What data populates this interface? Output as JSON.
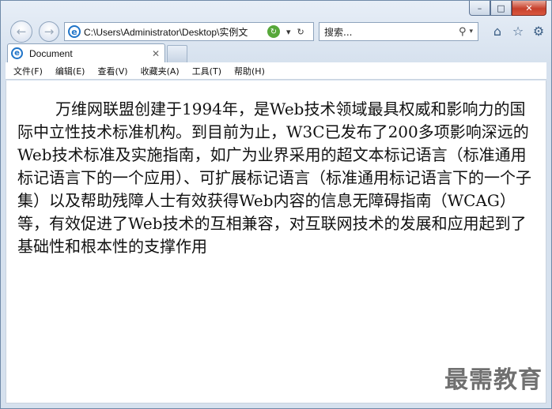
{
  "window": {
    "caption_buttons": {
      "minimize": "–",
      "maximize": "□",
      "close": "✕"
    }
  },
  "nav": {
    "back_icon": "back-arrow-icon",
    "forward_icon": "forward-arrow-icon",
    "address": "C:\\Users\\Administrator\\Desktop\\实例文",
    "search_placeholder": "搜索..."
  },
  "tab": {
    "title": "Document",
    "close_label": "✕"
  },
  "menu": {
    "items": [
      "文件(F)",
      "编辑(E)",
      "查看(V)",
      "收藏夹(A)",
      "工具(T)",
      "帮助(H)"
    ]
  },
  "content": {
    "paragraph": "万维网联盟创建于1994年，是Web技术领域最具权威和影响力的国际中立性技术标准机构。到目前为止，W3C已发布了200多项影响深远的Web技术标准及实施指南，如广为业界采用的超文本标记语言（标准通用标记语言下的一个应用）、可扩展标记语言（标准通用标记语言下的一个子集）以及帮助残障人士有效获得Web内容的信息无障碍指南（WCAG）等，有效促进了Web技术的互相兼容，对互联网技术的发展和应用起到了基础性和根本性的支撑作用"
  },
  "watermark": "最需教育"
}
